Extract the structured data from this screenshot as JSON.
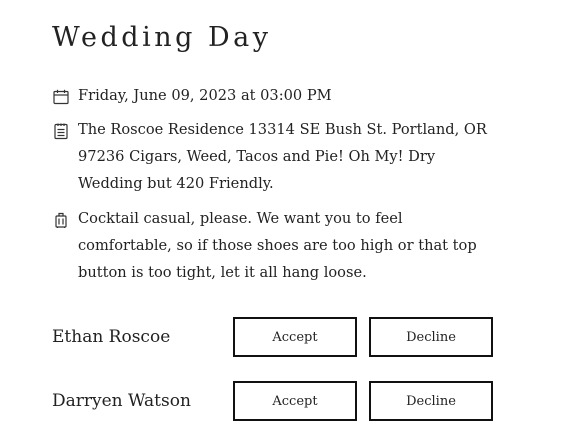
{
  "event": {
    "title": "Wedding Day",
    "date": "Friday, June 09, 2023 at 03:00 PM",
    "location": "The Roscoe Residence 13314 SE Bush St. Portland, OR 97236 Cigars, Weed, Tacos and Pie! Oh My! Dry Wedding but 420 Friendly.",
    "attire": "Cocktail casual, please. We want you to feel comfortable, so if those shoes are too high or that top button is too tight, let it all hang loose."
  },
  "icons": {
    "date": "calendar-icon",
    "location": "notes-icon",
    "attire": "suitcase-icon"
  },
  "guests": [
    {
      "name": "Ethan Roscoe",
      "accept_label": "Accept",
      "decline_label": "Decline"
    },
    {
      "name": "Darryen Watson",
      "accept_label": "Accept",
      "decline_label": "Decline"
    }
  ]
}
